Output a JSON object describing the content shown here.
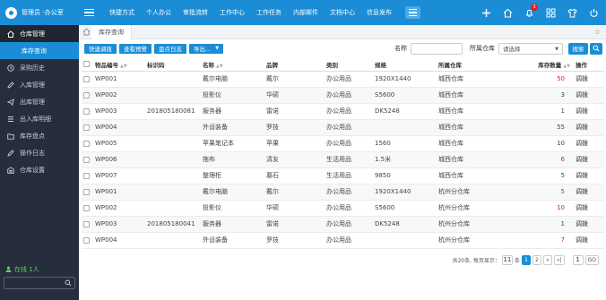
{
  "header": {
    "user_label": "管理员 -办公室",
    "nav": [
      "快捷方式",
      "个人办公",
      "审批流转",
      "工作中心",
      "工作任务",
      "内部邮件",
      "文档中心",
      "信息发布"
    ],
    "notification_count": "3"
  },
  "sidebar": {
    "items": [
      {
        "label": "仓库管理",
        "icon": "home-icon"
      },
      {
        "label": "库存查询",
        "icon": ""
      },
      {
        "label": "采购历史",
        "icon": "clock-icon"
      },
      {
        "label": "入库管理",
        "icon": "pencil-icon"
      },
      {
        "label": "出库管理",
        "icon": "send-icon"
      },
      {
        "label": "出入库明细",
        "icon": "list-icon"
      },
      {
        "label": "库存盘点",
        "icon": "folder-icon"
      },
      {
        "label": "操作日志",
        "icon": "pencil-icon"
      },
      {
        "label": "仓库设置",
        "icon": "storage-icon"
      }
    ],
    "online": "在线 1人"
  },
  "tabs": {
    "active": "库存查询"
  },
  "toolbar": {
    "quick_transfer": "快速调拨",
    "view_alert": "查看预警",
    "inventory_log": "盘点日志",
    "export": "导出..."
  },
  "filter": {
    "name_label": "名称",
    "warehouse_label": "所属仓库",
    "warehouse_select": "请选择",
    "search_button": "搜索"
  },
  "table": {
    "headers": [
      "物品编号",
      "标识码",
      "名称",
      "品牌",
      "类别",
      "规格",
      "所属仓库",
      "库存数量",
      "操作"
    ],
    "rows": [
      {
        "code": "WP001",
        "tag": "",
        "name": "戴尔电脑",
        "brand": "戴尔",
        "category": "办公用品",
        "spec": "1920X1440",
        "warehouse": "城西仓库",
        "qty": "50",
        "qty_red": true,
        "action": "调拨"
      },
      {
        "code": "WP002",
        "tag": "",
        "name": "投影仪",
        "brand": "华硕",
        "category": "办公用品",
        "spec": "S5600",
        "warehouse": "城西仓库",
        "qty": "3",
        "qty_red": false,
        "action": "调拨"
      },
      {
        "code": "WP003",
        "tag": "201805180081",
        "name": "服务器",
        "brand": "雷诺",
        "category": "办公用品",
        "spec": "DK5248",
        "warehouse": "城西仓库",
        "qty": "1",
        "qty_red": false,
        "action": "调拨"
      },
      {
        "code": "WP004",
        "tag": "",
        "name": "外设装备",
        "brand": "罗技",
        "category": "办公用品",
        "spec": "",
        "warehouse": "城西仓库",
        "qty": "55",
        "qty_red": false,
        "action": "调拨"
      },
      {
        "code": "WP005",
        "tag": "",
        "name": "苹果笔记本",
        "brand": "苹果",
        "category": "办公用品",
        "spec": "1560",
        "warehouse": "城西仓库",
        "qty": "10",
        "qty_red": false,
        "action": "调拨"
      },
      {
        "code": "WP006",
        "tag": "",
        "name": "拖布",
        "brand": "清友",
        "category": "生活用品",
        "spec": "1.5米",
        "warehouse": "城西仓库",
        "qty": "6",
        "qty_red": true,
        "action": "调拨"
      },
      {
        "code": "WP007",
        "tag": "",
        "name": "整理柜",
        "brand": "墓石",
        "category": "生活用品",
        "spec": "9850",
        "warehouse": "城西仓库",
        "qty": "5",
        "qty_red": false,
        "action": "调拨"
      },
      {
        "code": "WP001",
        "tag": "",
        "name": "戴尔电脑",
        "brand": "戴尔",
        "category": "办公用品",
        "spec": "1920X1440",
        "warehouse": "杭州分仓库",
        "qty": "5",
        "qty_red": true,
        "action": "调拨"
      },
      {
        "code": "WP002",
        "tag": "",
        "name": "投影仪",
        "brand": "华硕",
        "category": "办公用品",
        "spec": "S5600",
        "warehouse": "杭州分仓库",
        "qty": "10",
        "qty_red": true,
        "action": "调拨"
      },
      {
        "code": "WP003",
        "tag": "201805180041",
        "name": "服务器",
        "brand": "雷诺",
        "category": "办公用品",
        "spec": "DK5248",
        "warehouse": "杭州分仓库",
        "qty": "1",
        "qty_red": false,
        "action": "调拨"
      },
      {
        "code": "WP004",
        "tag": "",
        "name": "外设装备",
        "brand": "罗技",
        "category": "办公用品",
        "spec": "",
        "warehouse": "杭州分仓库",
        "qty": "7",
        "qty_red": true,
        "action": "调拨"
      }
    ]
  },
  "pager": {
    "summary": "共20条, 每页显示：",
    "page_size": "11",
    "unit": "条",
    "pages": [
      "1",
      "2"
    ],
    "next": "»",
    "last": "»|",
    "goto_value": "1",
    "go_label": "GO"
  }
}
